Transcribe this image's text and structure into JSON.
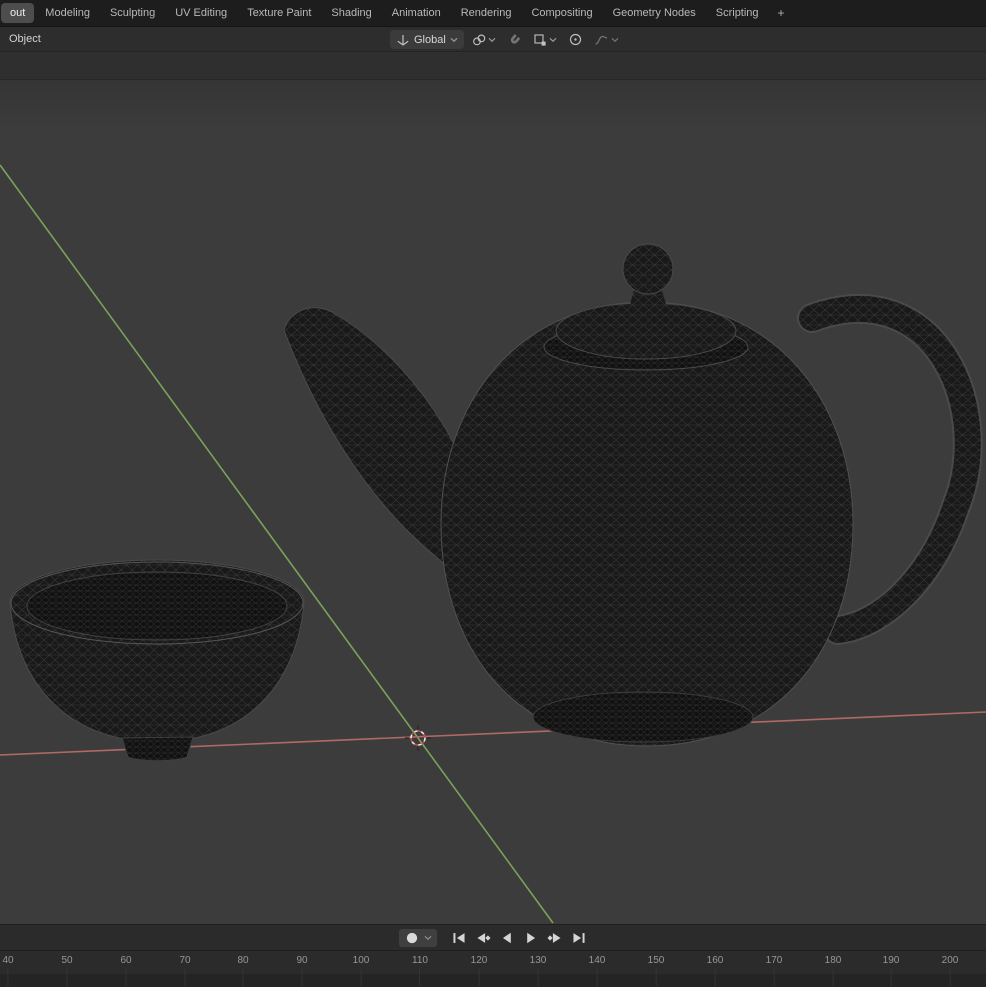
{
  "topbar": {
    "tabs": [
      {
        "label": "out",
        "active": true
      },
      {
        "label": "Modeling"
      },
      {
        "label": "Sculpting"
      },
      {
        "label": "UV Editing"
      },
      {
        "label": "Texture Paint"
      },
      {
        "label": "Shading"
      },
      {
        "label": "Animation"
      },
      {
        "label": "Rendering"
      },
      {
        "label": "Compositing"
      },
      {
        "label": "Geometry Nodes"
      },
      {
        "label": "Scripting"
      }
    ],
    "add_workspace_label": "+"
  },
  "viewport_header": {
    "mode_label": "Object",
    "orientation_label": "Global",
    "icons": [
      "orientation-icon",
      "pivot-point-icon",
      "snap-magnet-icon",
      "snap-target-icon",
      "proportional-editing-icon",
      "falloff-curve-icon"
    ]
  },
  "viewport": {
    "objects": [
      "teapot-wireframe",
      "bowl-wireframe"
    ],
    "overlays": [
      "3d-cursor",
      "y-axis-line",
      "x-axis-line"
    ]
  },
  "playback": {
    "buttons": [
      "auto-key-toggle",
      "jump-to-start",
      "jump-to-previous-keyframe",
      "play-reverse",
      "play-forward",
      "jump-to-next-keyframe",
      "jump-to-end"
    ]
  },
  "timeline": {
    "ticks": [
      "40",
      "50",
      "60",
      "70",
      "80",
      "90",
      "100",
      "110",
      "120",
      "130",
      "140",
      "150",
      "160",
      "170",
      "180",
      "190",
      "200"
    ]
  },
  "colors": {
    "topbar_bg": "#1d1d1d",
    "header_bg": "#2d2d2d",
    "viewport_bg": "#3c3c3c",
    "axis_y_green": "#7ba25a",
    "axis_x_red": "#b06a66",
    "cursor_red": "#cf4a43"
  }
}
